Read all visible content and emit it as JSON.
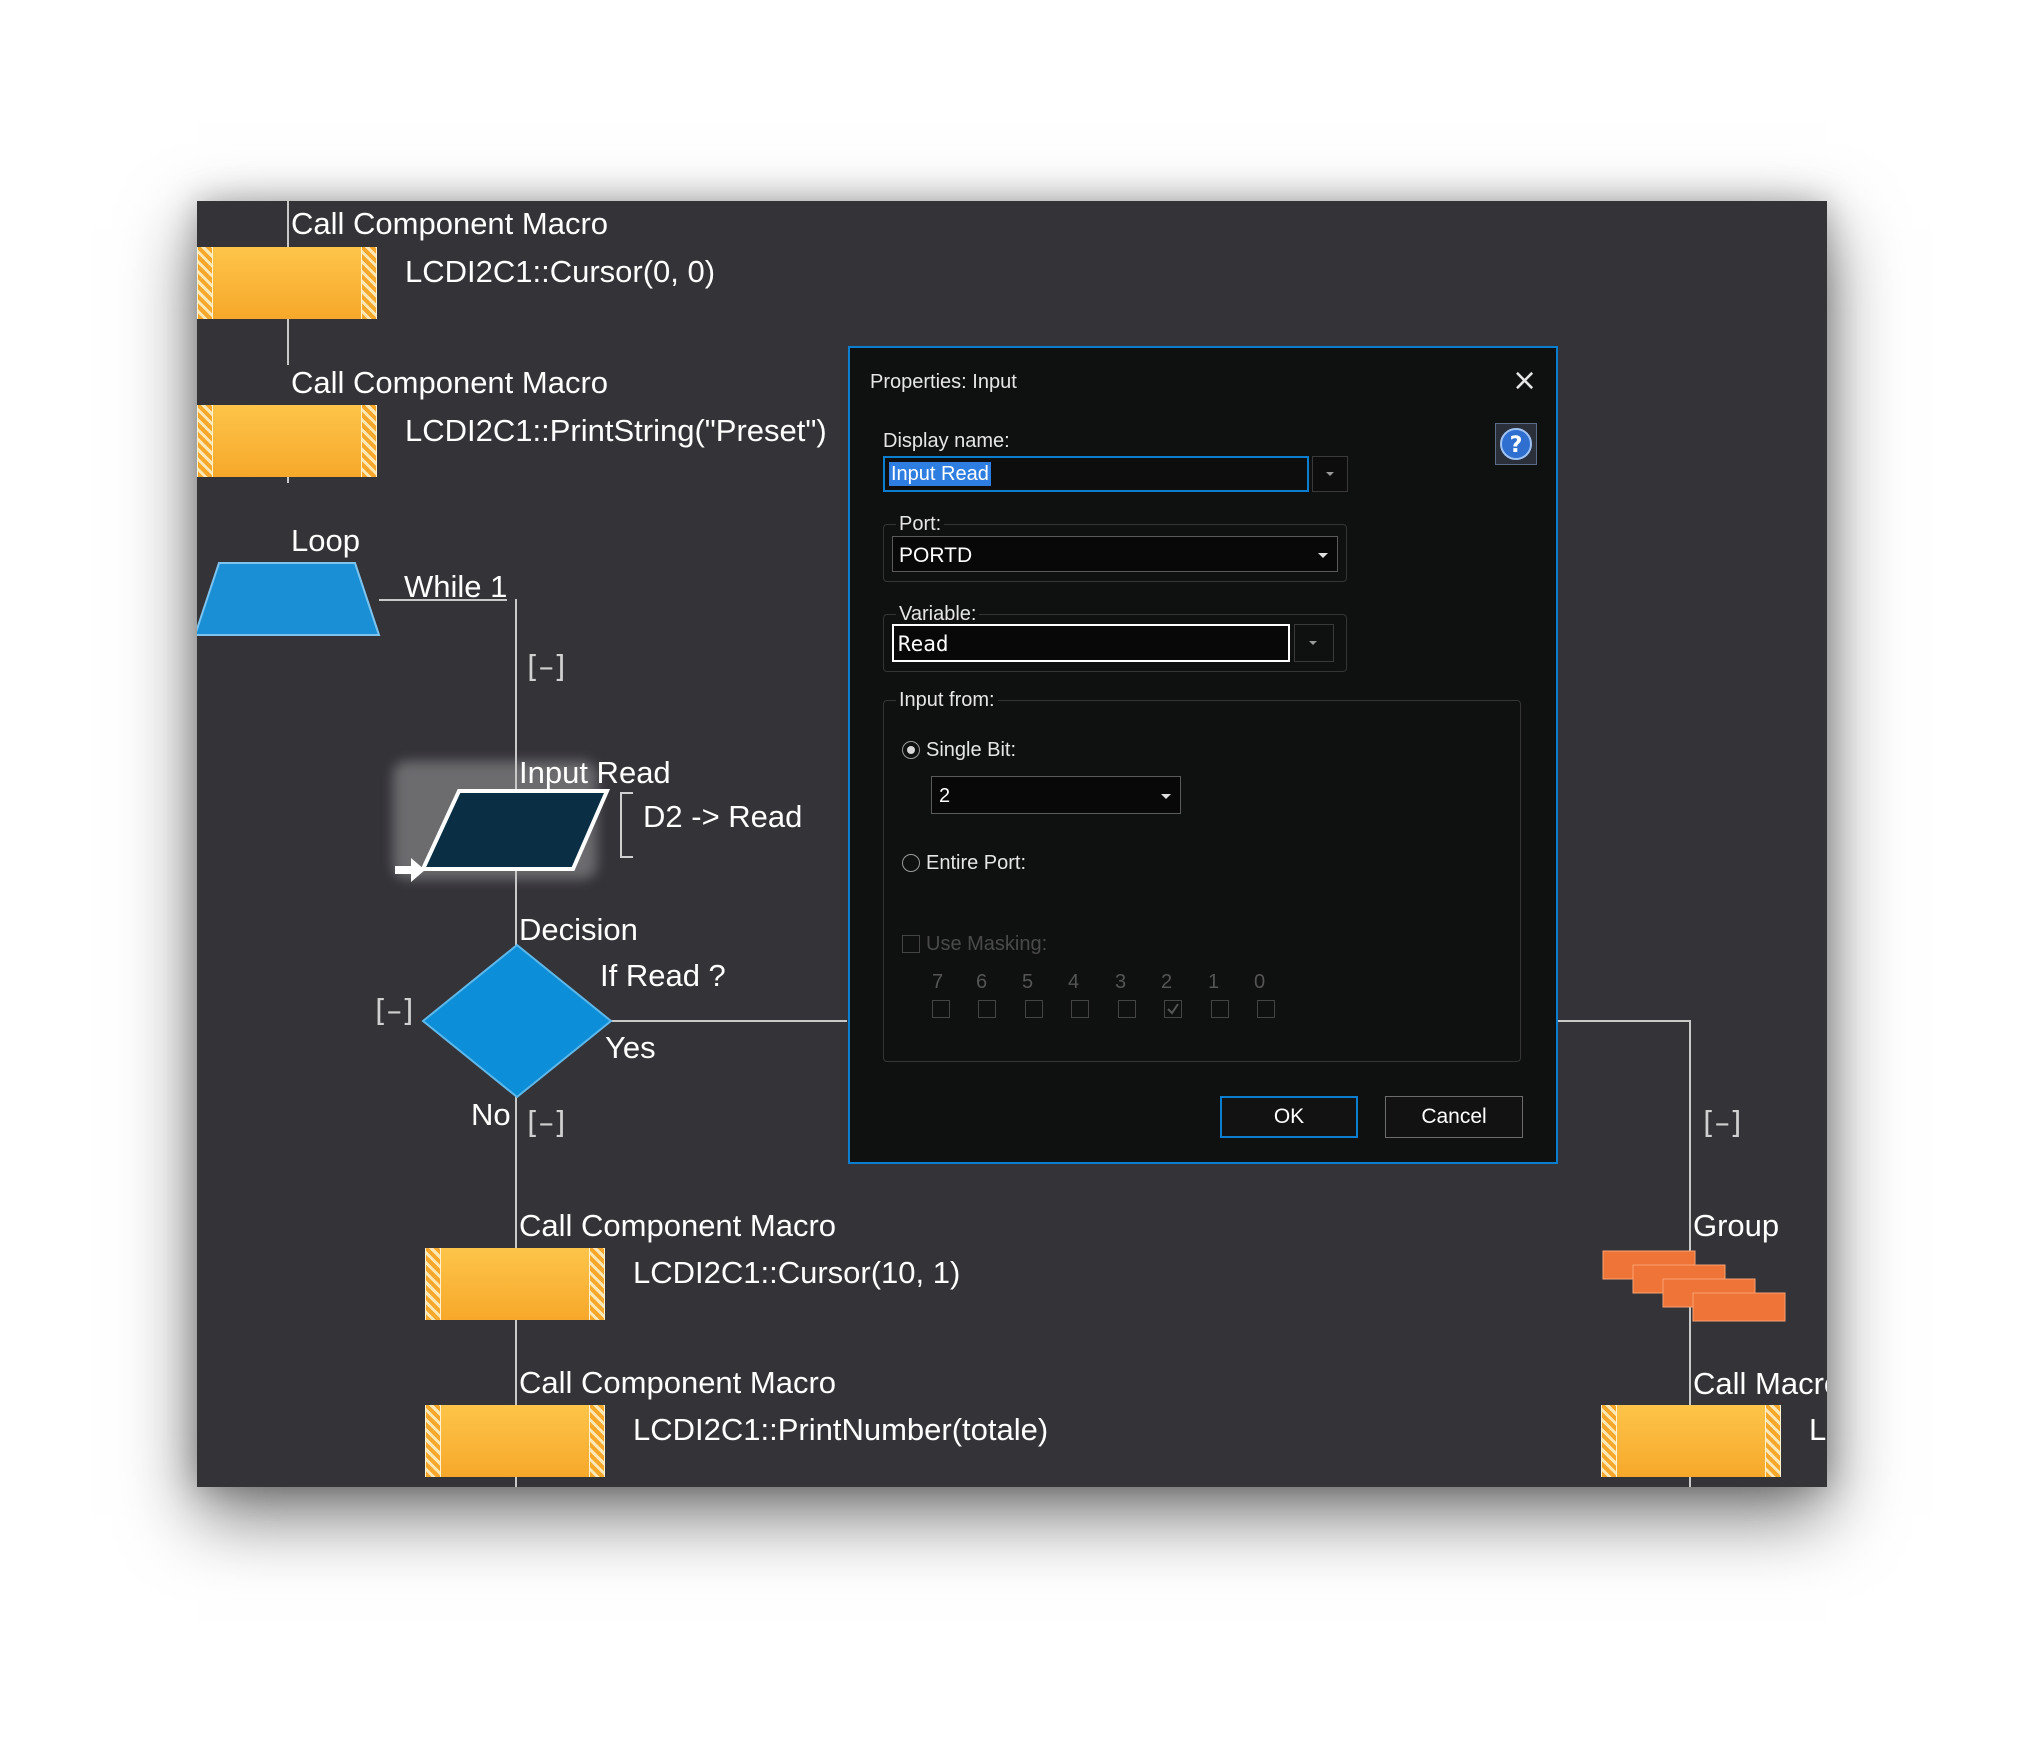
{
  "flow": {
    "macro1": {
      "type": "Call Component Macro",
      "call": "LCDI2C1::Cursor(0, 0)"
    },
    "macro2": {
      "type": "Call Component Macro",
      "call": "LCDI2C1::PrintString(\"Preset\")"
    },
    "loop": {
      "type": "Loop",
      "condition": "While 1"
    },
    "input": {
      "type": "Input Read",
      "expr": "D2 -> Read"
    },
    "decision": {
      "type": "Decision",
      "condition": "If  Read ?",
      "yes": "Yes",
      "no": "No"
    },
    "macro3": {
      "type": "Call Component Macro",
      "call": "LCDI2C1::Cursor(10, 1)"
    },
    "macro4": {
      "type": "Call Component Macro",
      "call": "LCDI2C1::PrintNumber(totale)"
    },
    "group": {
      "type": "Group"
    },
    "macro5": {
      "type": "Call Macro",
      "call": "L"
    },
    "collapse": "[–]"
  },
  "dialog": {
    "title": "Properties: Input",
    "close": "×",
    "display_name_label": "Display name:",
    "display_name_value": "Input Read",
    "port_label": "Port:",
    "port_value": "PORTD",
    "variable_label": "Variable:",
    "variable_value": "Read",
    "input_from_label": "Input from:",
    "single_bit_label": "Single Bit:",
    "single_bit_value": "2",
    "single_bit_selected": true,
    "entire_port_label": "Entire Port:",
    "use_masking_label": "Use Masking:",
    "mask_bits": [
      "7",
      "6",
      "5",
      "4",
      "3",
      "2",
      "1",
      "0"
    ],
    "mask_checked_bit": "2",
    "ok_label": "OK",
    "cancel_label": "Cancel",
    "help_icon": "help-icon"
  },
  "colors": {
    "canvas": "#343338",
    "macro": "#f9b233",
    "loop": "#1a8fd6",
    "decision": "#0c8fd8",
    "input": "#0a2f45",
    "group": "#ef7437",
    "dialog_accent": "#0b7ecf"
  }
}
